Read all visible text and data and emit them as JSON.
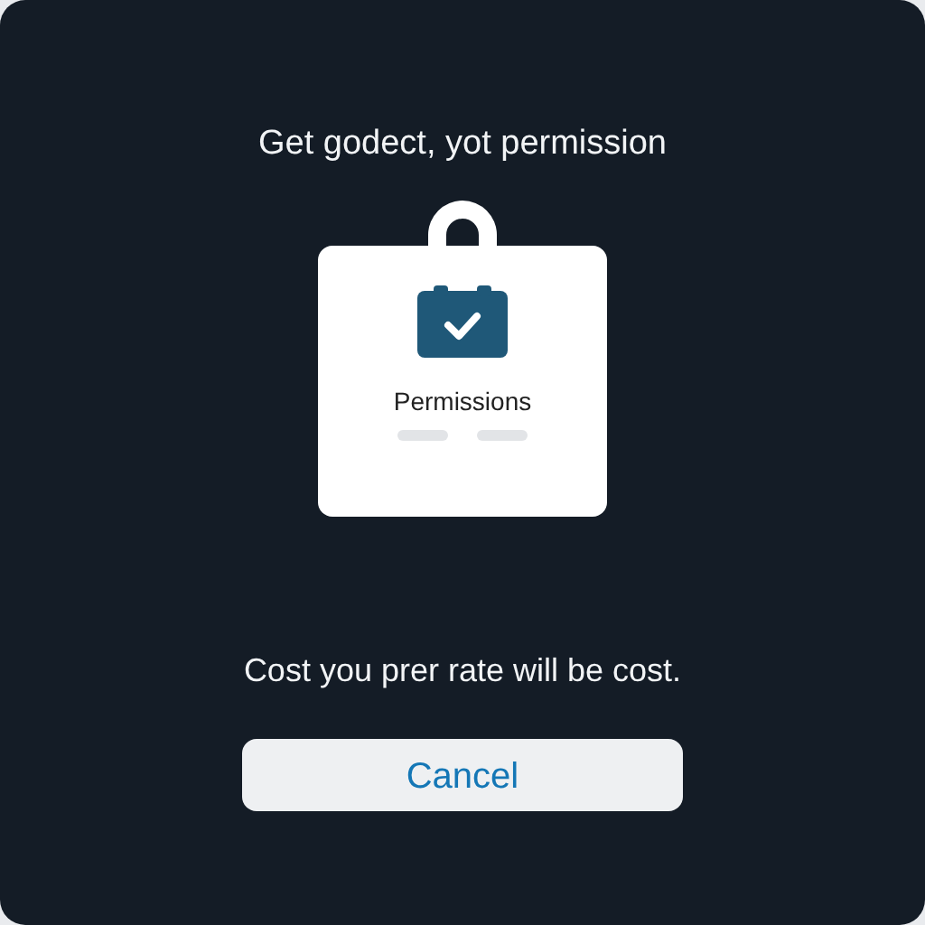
{
  "dialog": {
    "title": "Get godect, yot permission",
    "card": {
      "label": "Permissions",
      "checked": true
    },
    "message": "Cost you prer rate will be cost.",
    "buttons": [
      {
        "label": "Cancel"
      }
    ]
  }
}
